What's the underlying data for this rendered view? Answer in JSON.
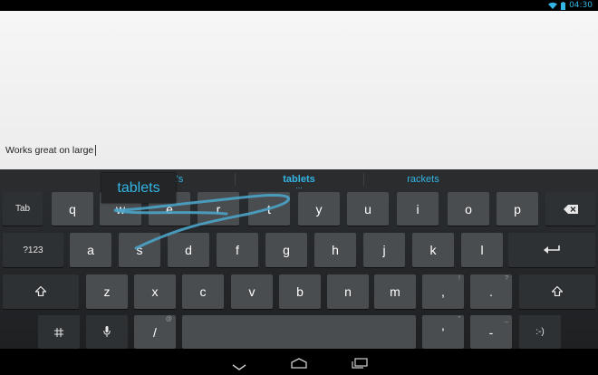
{
  "status_bar": {
    "time": "04:30",
    "wifi_icon": "wifi-icon",
    "battery_icon": "battery-icon"
  },
  "editor": {
    "text": "Works great on large"
  },
  "suggestions": {
    "left": "tablet's",
    "center": "tablets",
    "right": "rackets",
    "more_indicator": "..."
  },
  "gesture_preview": "tablets",
  "keyboard": {
    "row1": {
      "tab": "Tab",
      "keys": [
        "q",
        "w",
        "e",
        "r",
        "t",
        "y",
        "u",
        "i",
        "o",
        "p"
      ],
      "backspace_icon": "backspace-icon"
    },
    "row2": {
      "symbols": "?123",
      "keys": [
        "a",
        "s",
        "d",
        "f",
        "g",
        "h",
        "j",
        "k",
        "l"
      ],
      "enter_icon": "enter-icon"
    },
    "row3": {
      "shift_icon": "shift-icon",
      "keys": [
        "z",
        "x",
        "c",
        "v",
        "b",
        "n",
        "m",
        ",",
        "."
      ],
      "comma_hint": "!",
      "period_hint": "?"
    },
    "row4": {
      "settings_icon": "keyboard-settings-icon",
      "mic_icon": "microphone-icon",
      "slash": "/",
      "slash_hint": "@",
      "apostrophe": "'",
      "apostrophe_hint": "\"",
      "dash": "-",
      "dash_hint": "_",
      "smiley": ":-)"
    }
  },
  "navigation": {
    "back_icon": "back-icon",
    "home_icon": "home-icon",
    "recents_icon": "recent-apps-icon"
  },
  "colors": {
    "accent": "#33b5e5",
    "key": "#4a4d50",
    "key_dark": "#2e3134",
    "keyboard_bg": "#25282a"
  }
}
